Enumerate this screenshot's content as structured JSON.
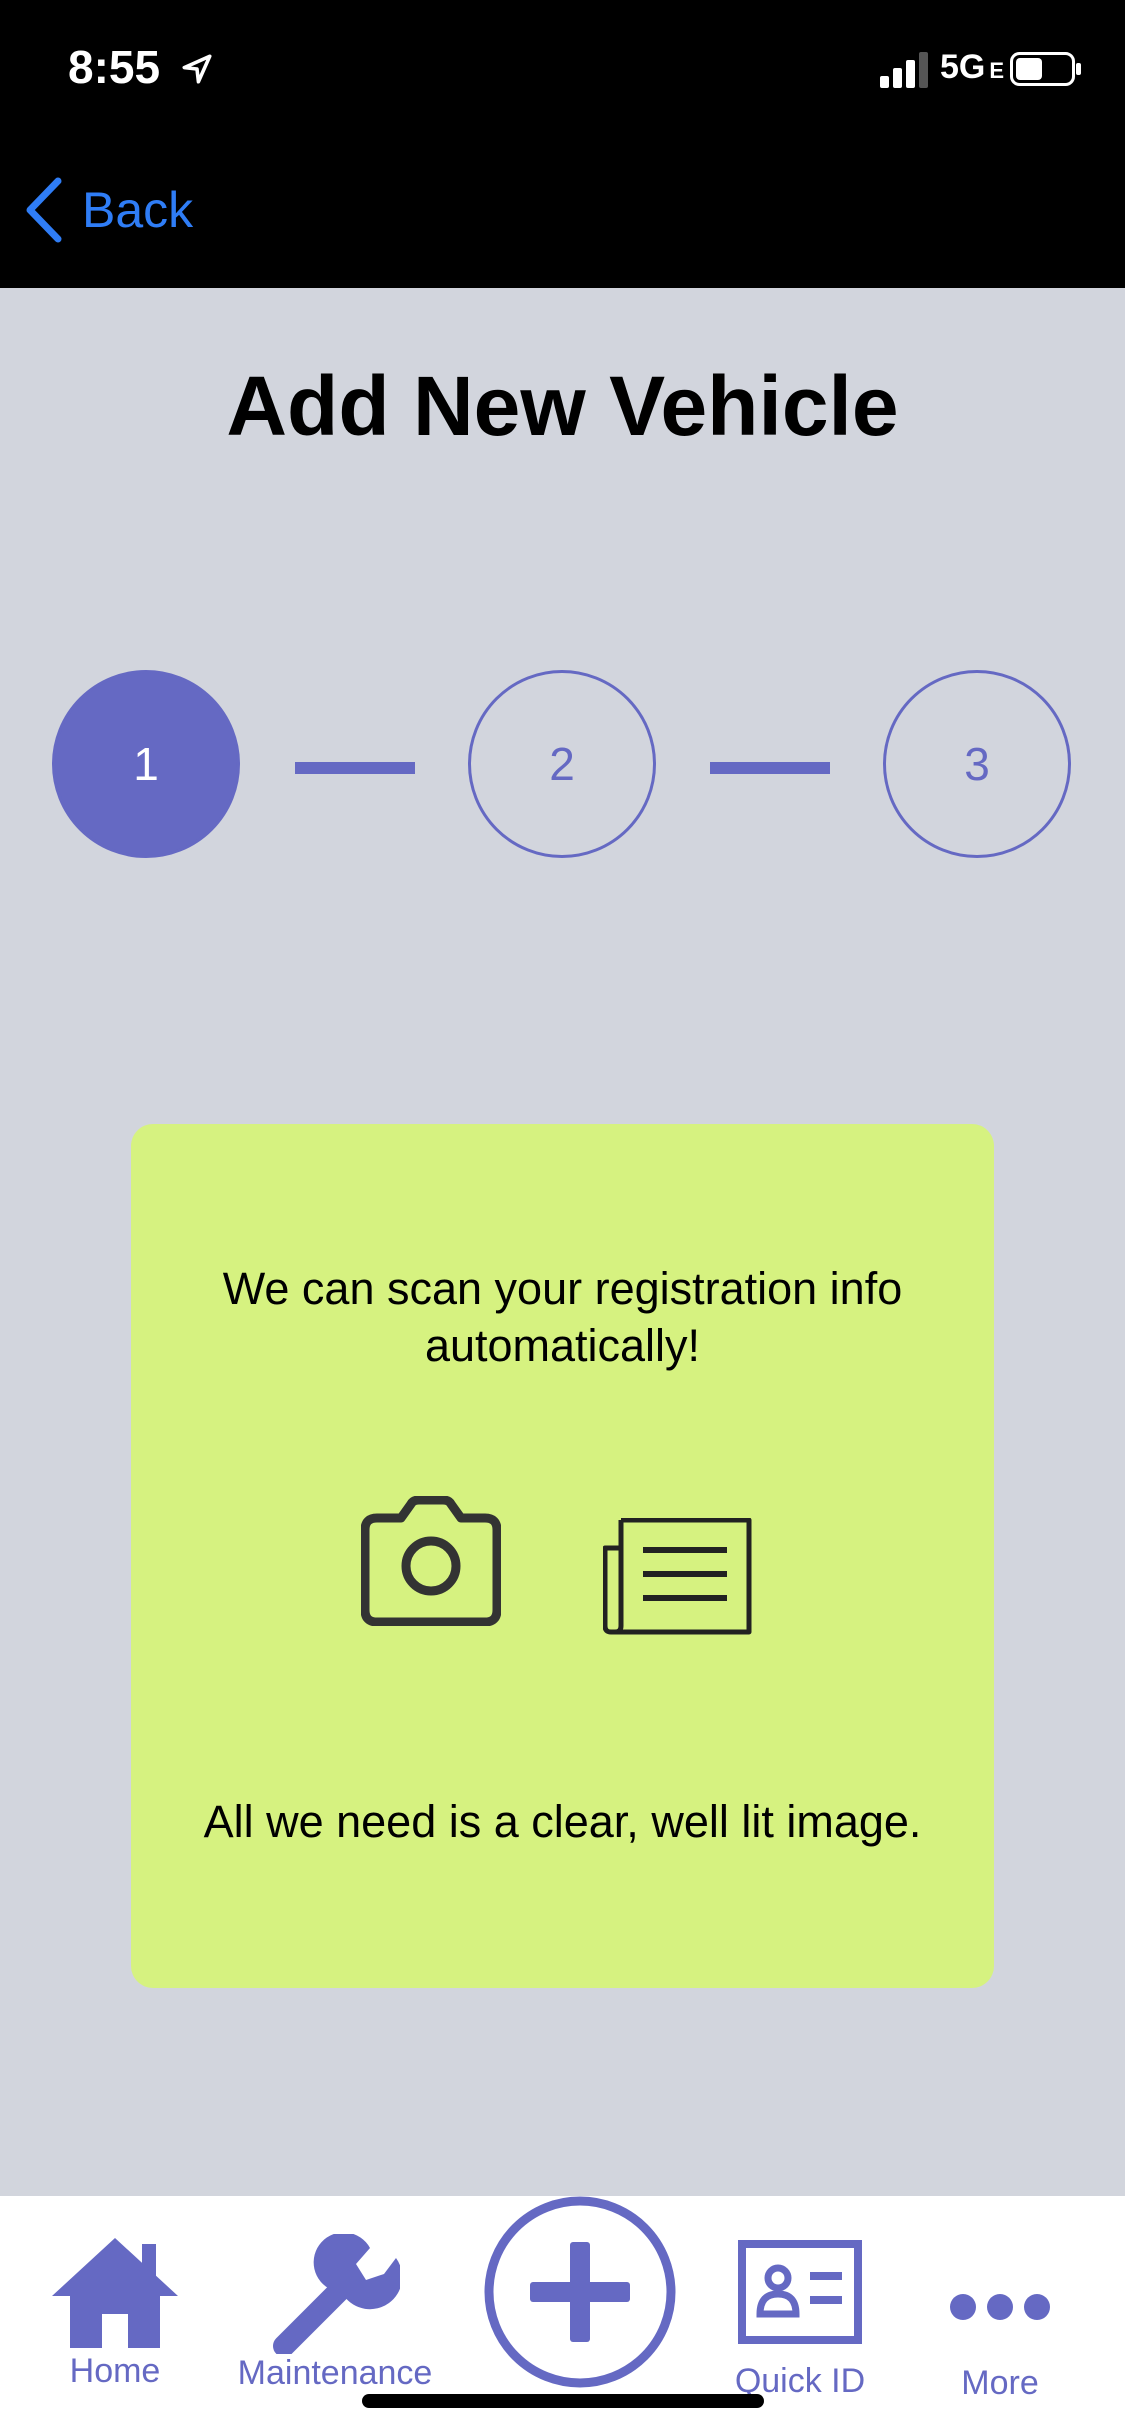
{
  "status_bar": {
    "time": "8:55",
    "network": "5G",
    "network_suffix": "E"
  },
  "nav": {
    "back_label": "Back"
  },
  "page": {
    "title": "Add New Vehicle"
  },
  "stepper": {
    "steps": [
      "1",
      "2",
      "3"
    ],
    "current_step": 1
  },
  "card": {
    "message": "We can scan your registration info automatically!",
    "note": "All we need is a clear, well lit image."
  },
  "tab_bar": {
    "items": [
      {
        "label": "Home",
        "icon": "home-icon"
      },
      {
        "label": "Maintenance",
        "icon": "wrench-icon"
      },
      {
        "label": "",
        "icon": "add-circle-icon"
      },
      {
        "label": "Quick ID",
        "icon": "id-card-icon"
      },
      {
        "label": "More",
        "icon": "more-dots-icon"
      }
    ]
  },
  "colors": {
    "accent": "#6569c3",
    "back_link": "#2f7df6",
    "card_bg": "#d6f280",
    "page_bg": "#d2d5dd"
  }
}
